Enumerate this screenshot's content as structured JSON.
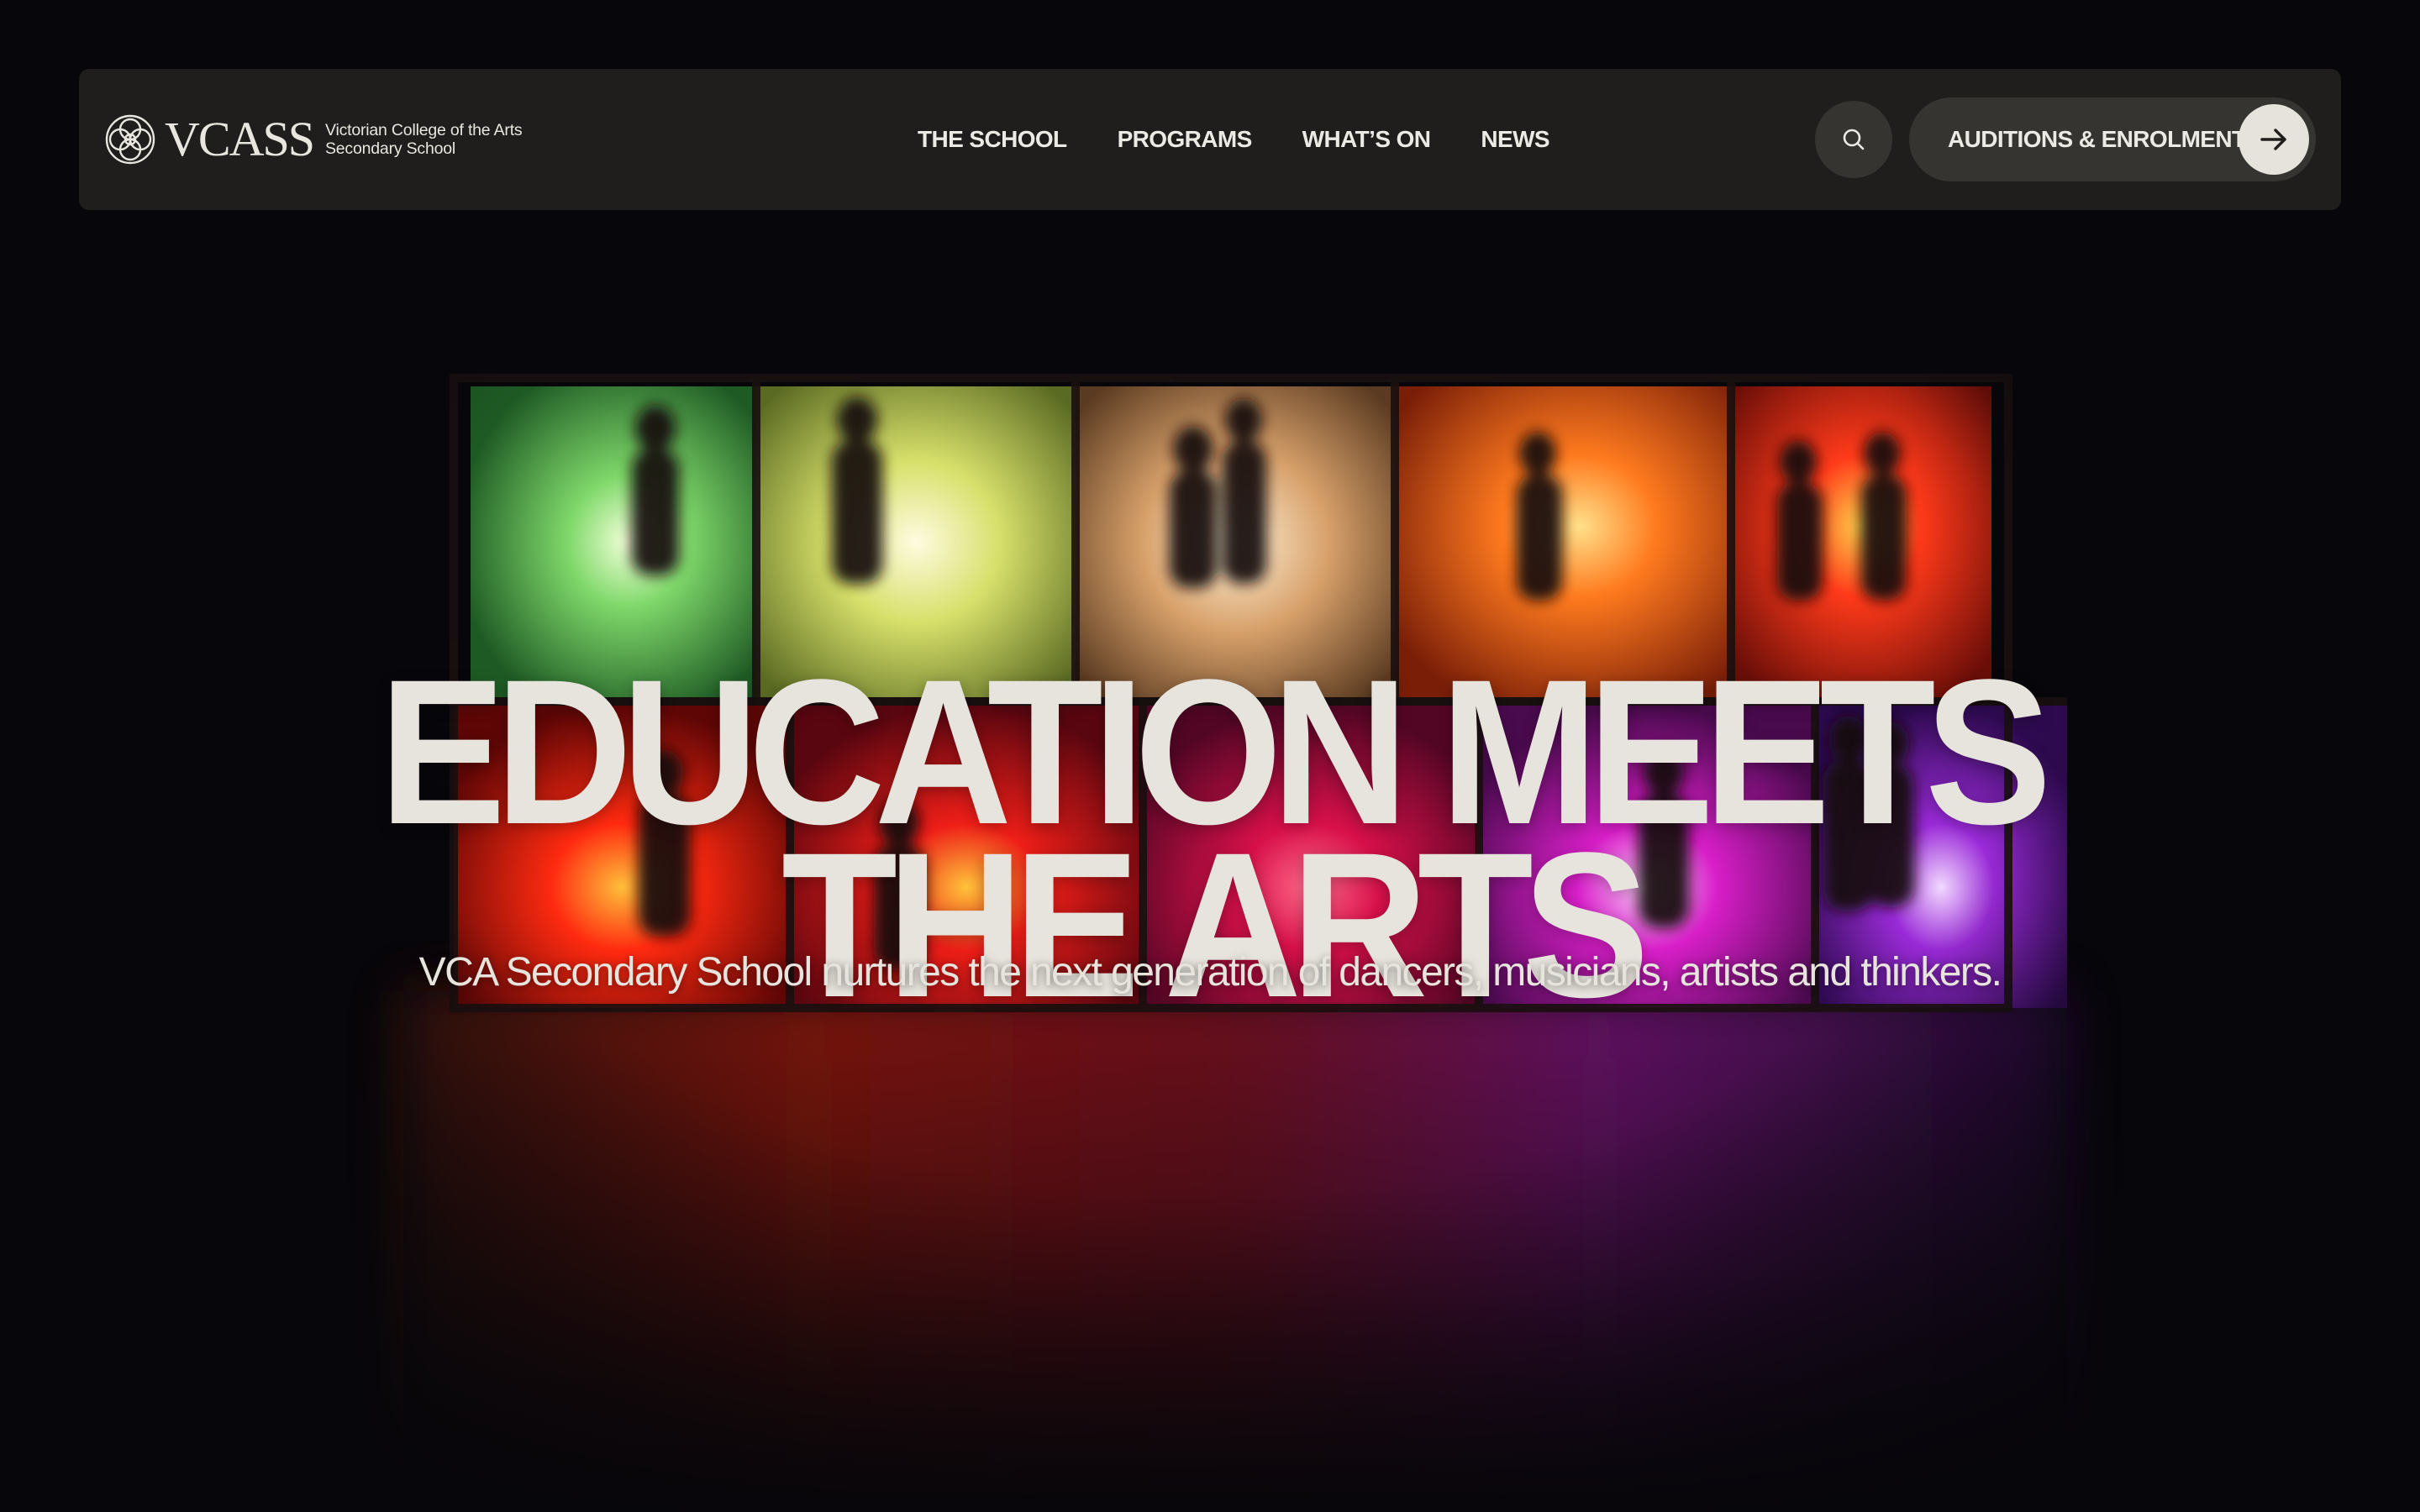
{
  "header": {
    "logo_word": "VCASS",
    "logo_sub_line1": "Victorian College of the Arts",
    "logo_sub_line2": "Secondary School",
    "nav": [
      {
        "label": "THE SCHOOL"
      },
      {
        "label": "PROGRAMS"
      },
      {
        "label": "WHAT’S ON"
      },
      {
        "label": "NEWS"
      }
    ],
    "search_icon": "search-icon",
    "cta_label": "AUDITIONS & ENROLMENT",
    "cta_icon": "arrow-right-icon"
  },
  "hero": {
    "headline_line1": "EDUCATION MEETS",
    "headline_line2": "THE ARTS",
    "subtitle": "VCA Secondary School nurtures the next generation of dancers, musicians, artists and thinkers."
  },
  "colors": {
    "background": "#07060a",
    "navbar": "#1f1e1c",
    "button": "#353431",
    "text": "#e7e4dd"
  }
}
